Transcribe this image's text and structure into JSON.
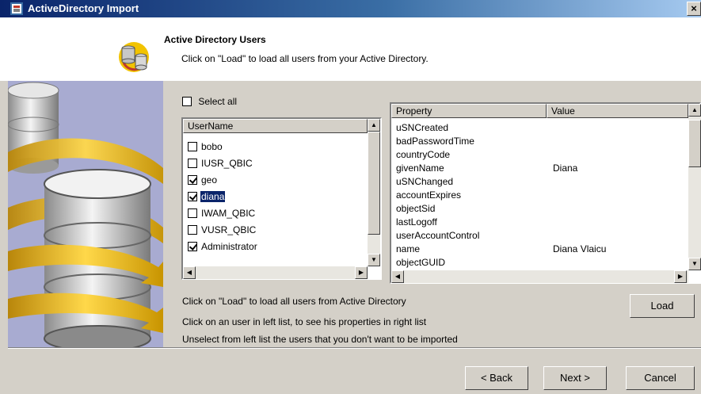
{
  "window": {
    "title": "ActiveDirectory Import",
    "close_glyph": "×"
  },
  "header": {
    "title": "Active Directory Users",
    "subtitle": "Click on \"Load\" to load all users from your Active Directory."
  },
  "select_all": {
    "label": "Select all",
    "checked": false
  },
  "users": {
    "column": "UserName",
    "items": [
      {
        "name": "bobo",
        "checked": false,
        "selected": false
      },
      {
        "name": "IUSR_QBIC",
        "checked": false,
        "selected": false
      },
      {
        "name": "geo",
        "checked": true,
        "selected": false
      },
      {
        "name": "diana",
        "checked": true,
        "selected": true
      },
      {
        "name": "IWAM_QBIC",
        "checked": false,
        "selected": false
      },
      {
        "name": "VUSR_QBIC",
        "checked": false,
        "selected": false
      },
      {
        "name": "Administrator",
        "checked": true,
        "selected": false
      }
    ]
  },
  "properties": {
    "col_property": "Property",
    "col_value": "Value",
    "rows": [
      {
        "property": "uSNCreated",
        "value": ""
      },
      {
        "property": "badPasswordTime",
        "value": ""
      },
      {
        "property": "countryCode",
        "value": ""
      },
      {
        "property": "givenName",
        "value": "Diana"
      },
      {
        "property": "uSNChanged",
        "value": ""
      },
      {
        "property": "accountExpires",
        "value": ""
      },
      {
        "property": "objectSid",
        "value": ""
      },
      {
        "property": "lastLogoff",
        "value": ""
      },
      {
        "property": "userAccountControl",
        "value": ""
      },
      {
        "property": "name",
        "value": "Diana Vlaicu"
      },
      {
        "property": "objectGUID",
        "value": ""
      }
    ]
  },
  "instructions": {
    "line1": "Click on \"Load\" to load all users from Active Directory",
    "line2": "Click on an user in left list, to see his properties in right list",
    "line3": "Unselect from left list the users that you don't want to be imported"
  },
  "buttons": {
    "load": "Load",
    "back": "< Back",
    "next": "Next >",
    "cancel": "Cancel"
  },
  "icons": {
    "app": "database-import-icon",
    "header": "database-sync-icon",
    "art": "database-wizard-art"
  }
}
